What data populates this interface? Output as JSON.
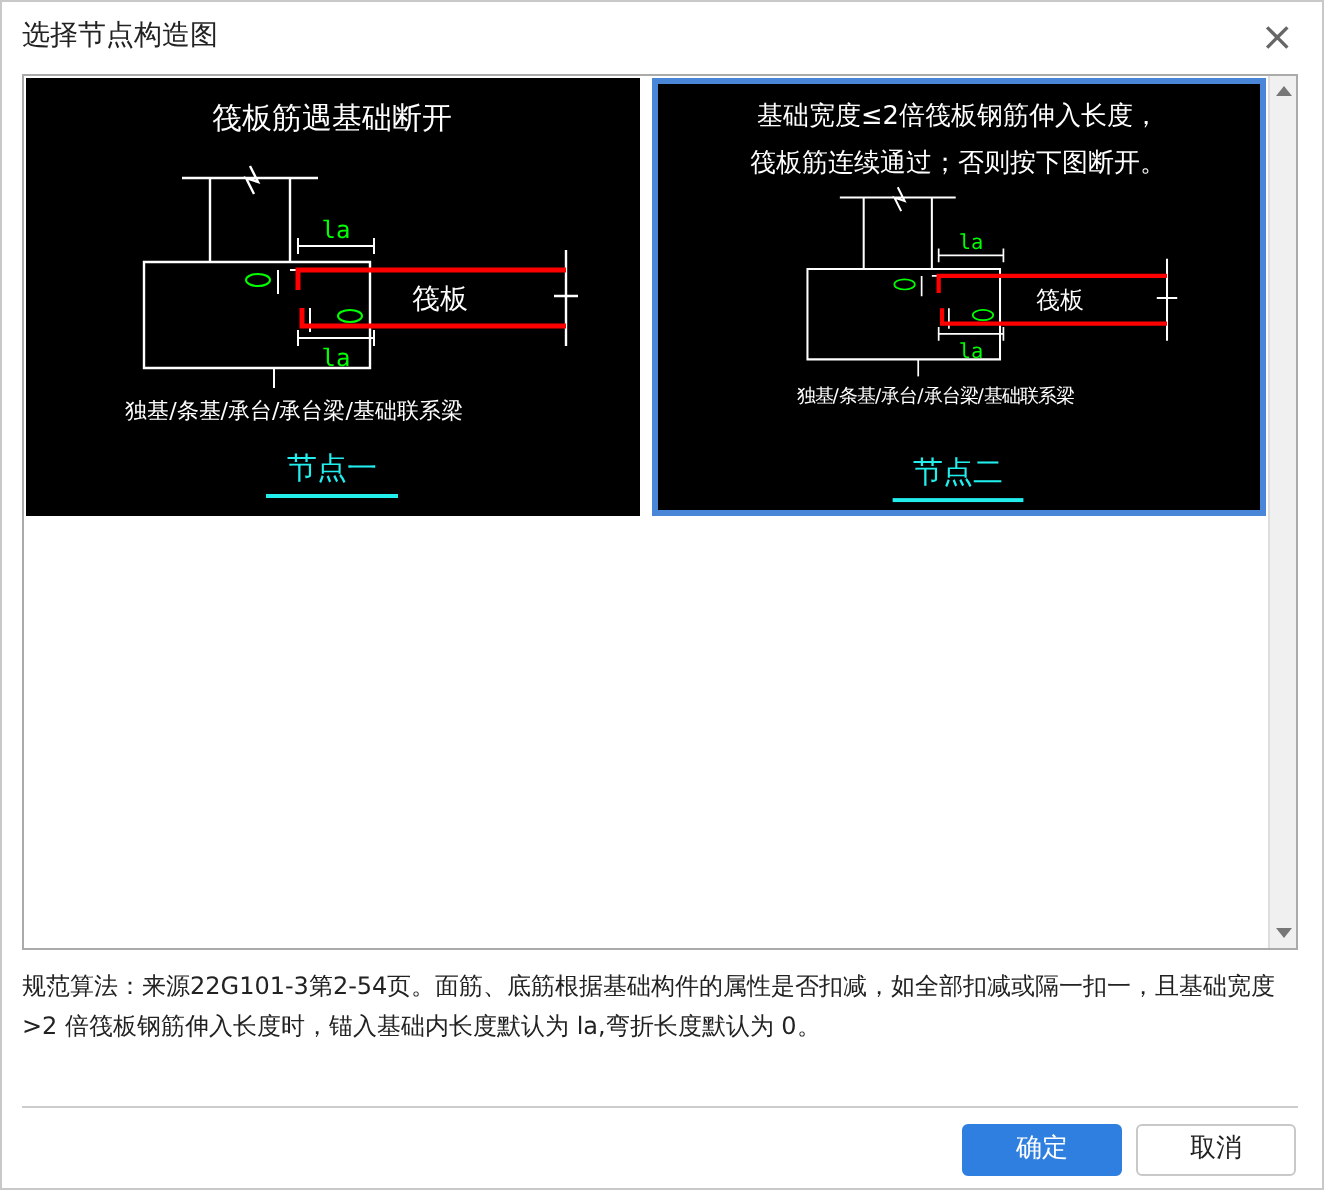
{
  "window": {
    "title": "选择节点构造图",
    "close": "×"
  },
  "nodes": [
    {
      "title_lines": [
        "筏板筋遇基础断开"
      ],
      "slab_label": "筏板",
      "la_top": "la",
      "la_bottom": "la",
      "caption": "独基/条基/承台/承台梁/基础联系梁",
      "node_label": "节点一",
      "selected": false
    },
    {
      "title_lines": [
        "基础宽度≤2倍筏板钢筋伸入长度，",
        "筏板筋连续通过；否则按下图断开。"
      ],
      "slab_label": "筏板",
      "la_top": "la",
      "la_bottom": "la",
      "caption": "独基/条基/承台/承台梁/基础联系梁",
      "node_label": "节点二",
      "selected": true
    }
  ],
  "description": "规范算法：来源22G101-3第2-54页。面筋、底筋根据基础构件的属性是否扣减，如全部扣减或隔一扣一，且基础宽度>2 倍筏板钢筋伸入长度时，锚入基础内长度默认为 la,弯折长度默认为 0。",
  "buttons": [
    {
      "label": "确定",
      "kind": "primary"
    },
    {
      "label": "取消",
      "kind": "secondary"
    }
  ]
}
